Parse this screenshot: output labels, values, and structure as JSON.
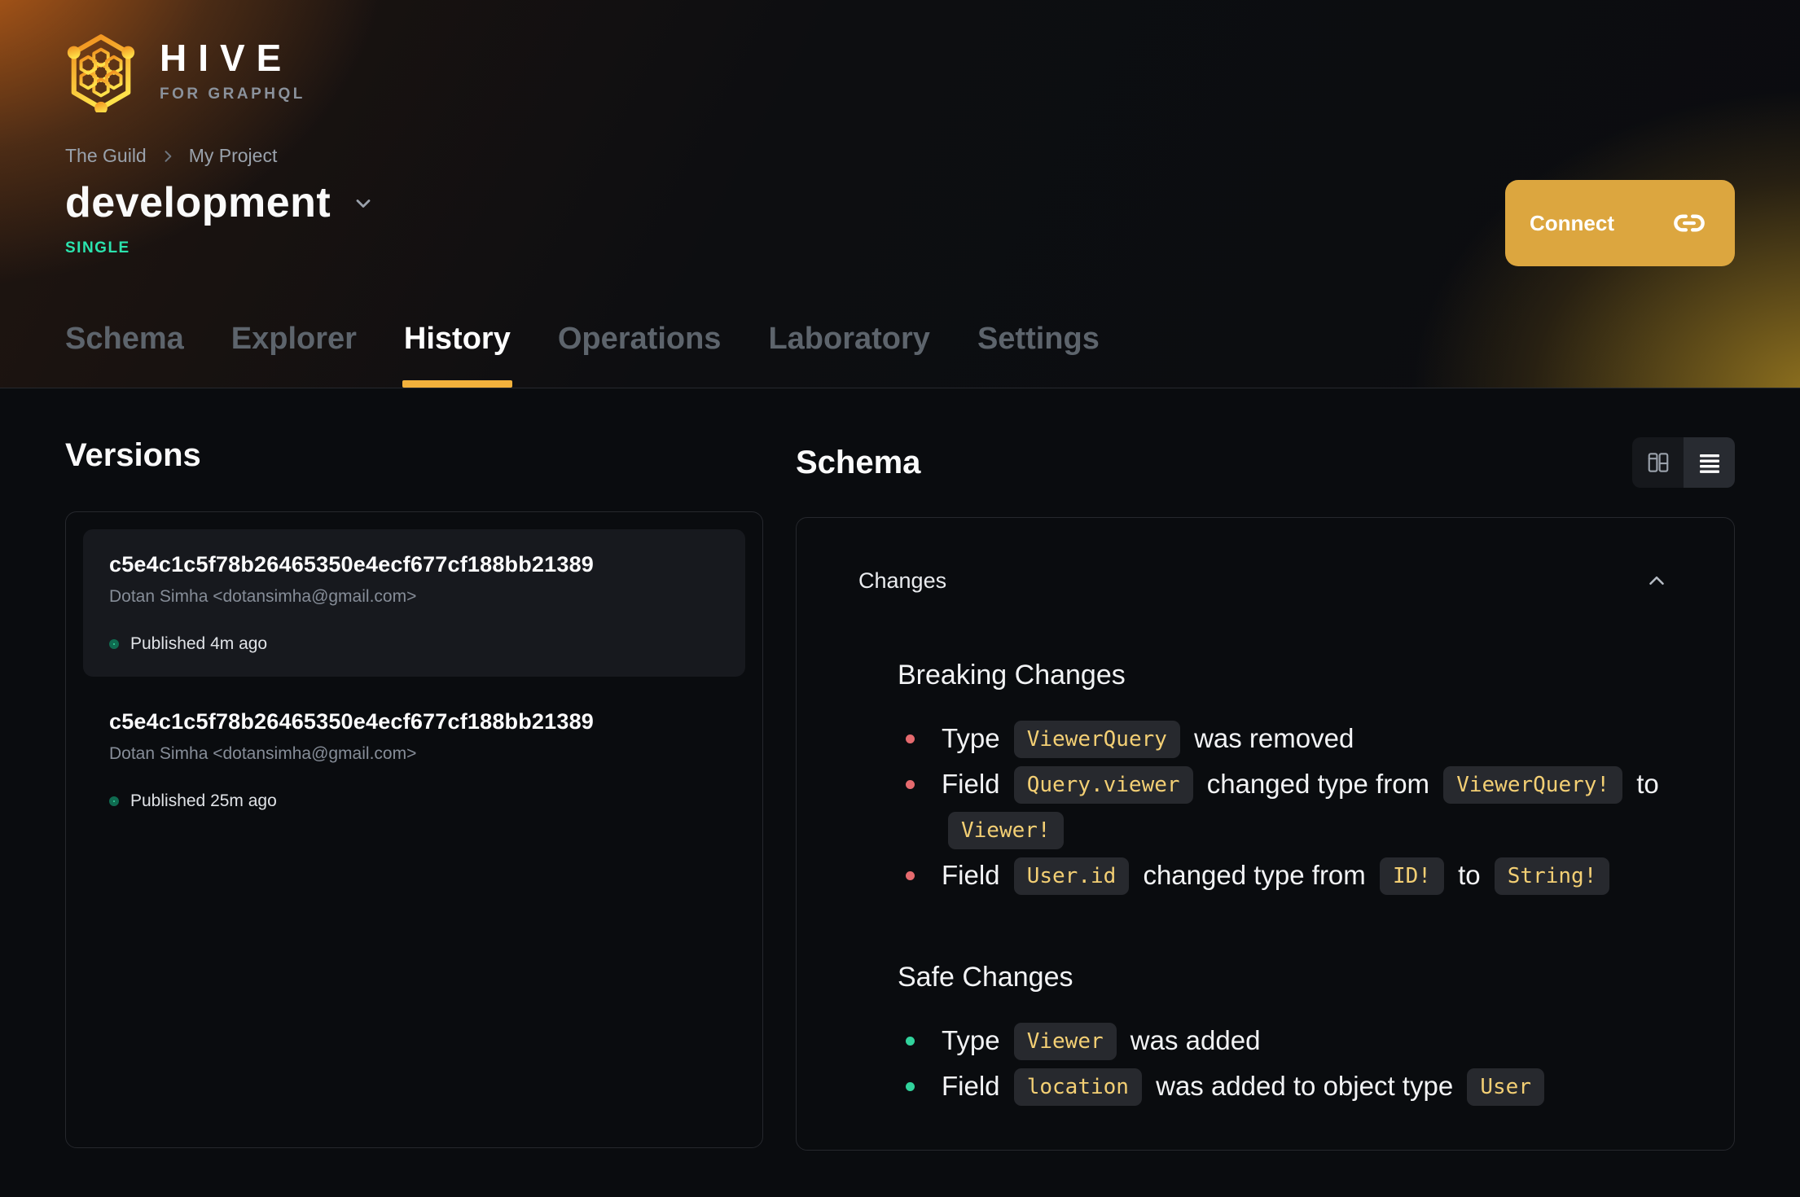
{
  "brand": {
    "name": "HIVE",
    "tagline": "FOR GRAPHQL"
  },
  "breadcrumb": {
    "org": "The Guild",
    "project": "My Project"
  },
  "target": {
    "title": "development",
    "badge": "SINGLE"
  },
  "connect": {
    "label": "Connect"
  },
  "tabs": [
    {
      "label": "Schema",
      "active": false
    },
    {
      "label": "Explorer",
      "active": false
    },
    {
      "label": "History",
      "active": true
    },
    {
      "label": "Operations",
      "active": false
    },
    {
      "label": "Laboratory",
      "active": false
    },
    {
      "label": "Settings",
      "active": false
    }
  ],
  "versions": {
    "heading": "Versions",
    "items": [
      {
        "hash": "c5e4c1c5f78b26465350e4ecf677cf188bb21389",
        "author": "Dotan Simha <dotansimha@gmail.com>",
        "status": "Published 4m ago"
      },
      {
        "hash": "c5e4c1c5f78b26465350e4ecf677cf188bb21389",
        "author": "Dotan Simha <dotansimha@gmail.com>",
        "status": "Published 25m ago"
      }
    ]
  },
  "schema_panel": {
    "heading": "Schema",
    "card_title": "Changes",
    "sections": [
      {
        "title": "Breaking Changes",
        "items": [
          "Type `ViewerQuery` was removed",
          "Field `Query.viewer` changed type from `ViewerQuery!` to `Viewer!`",
          "Field `User.id` changed type from `ID!` to `String!`"
        ]
      },
      {
        "title": "Safe Changes",
        "items": [
          "Type `Viewer` was added",
          "Field `location` was added to object type `User`"
        ]
      }
    ]
  },
  "colors": {
    "accent_amber": "#dca63f",
    "tab_underline": "#f2b13c",
    "badge_green": "#2be3ae",
    "breaking_bullet": "#e56a6e",
    "safe_bullet": "#31d39c",
    "chip_text": "#f3cf74",
    "chip_bg": "#27292e",
    "page_bg": "#0a0c0f"
  }
}
